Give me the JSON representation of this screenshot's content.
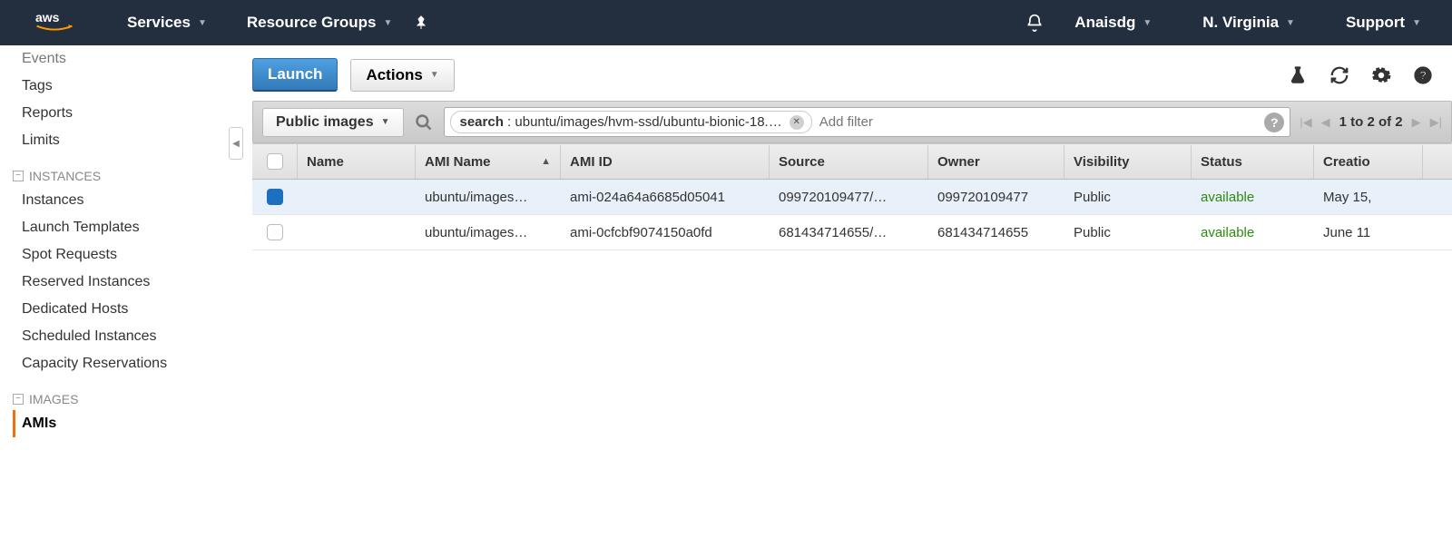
{
  "nav": {
    "services": "Services",
    "resource_groups": "Resource Groups",
    "user": "Anaisdg",
    "region": "N. Virginia",
    "support": "Support"
  },
  "sidebar": {
    "top_items": [
      "Events",
      "Tags",
      "Reports",
      "Limits"
    ],
    "instances_label": "INSTANCES",
    "instances_items": [
      "Instances",
      "Launch Templates",
      "Spot Requests",
      "Reserved Instances",
      "Dedicated Hosts",
      "Scheduled Instances",
      "Capacity Reservations"
    ],
    "images_label": "IMAGES",
    "images_items": [
      "AMIs"
    ]
  },
  "toolbar": {
    "launch": "Launch",
    "actions": "Actions"
  },
  "filter": {
    "scope": "Public images",
    "search_key": "search",
    "search_val": "ubuntu/images/hvm-ssd/ubuntu-bionic-18.…",
    "placeholder": "Add filter",
    "range": "1 to 2 of 2"
  },
  "columns": {
    "name": "Name",
    "ami_name": "AMI Name",
    "ami_id": "AMI ID",
    "source": "Source",
    "owner": "Owner",
    "visibility": "Visibility",
    "status": "Status",
    "creation": "Creatio"
  },
  "rows": [
    {
      "selected": true,
      "name": "",
      "ami_name": "ubuntu/images…",
      "ami_id": "ami-024a64a6685d05041",
      "source": "099720109477/…",
      "owner": "099720109477",
      "visibility": "Public",
      "status": "available",
      "creation": "May 15,"
    },
    {
      "selected": false,
      "name": "",
      "ami_name": "ubuntu/images…",
      "ami_id": "ami-0cfcbf9074150a0fd",
      "source": "681434714655/…",
      "owner": "681434714655",
      "visibility": "Public",
      "status": "available",
      "creation": "June 11"
    }
  ]
}
